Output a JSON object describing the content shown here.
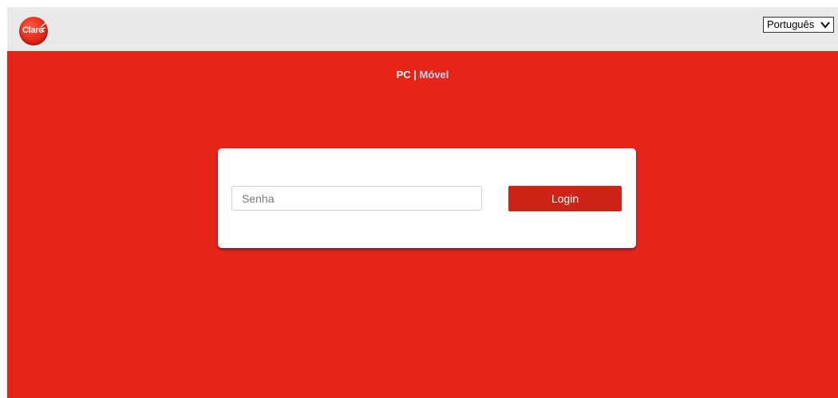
{
  "header": {
    "logo_text": "Claro",
    "language_select": {
      "selected": "Português"
    }
  },
  "mode_switch": {
    "pc_label": "PC",
    "separator": "|",
    "mobile_label": "Móvel"
  },
  "login_form": {
    "password_placeholder": "Senha",
    "password_value": "",
    "login_label": "Login"
  },
  "colors": {
    "brand_red": "#e62518",
    "header_bg": "#e9e9e9",
    "button_red": "#cf2318",
    "link_inactive": "#c7d6ef"
  },
  "icons": {
    "logo": "claro-logo-icon",
    "language_dropdown": "chevron-down-icon"
  }
}
